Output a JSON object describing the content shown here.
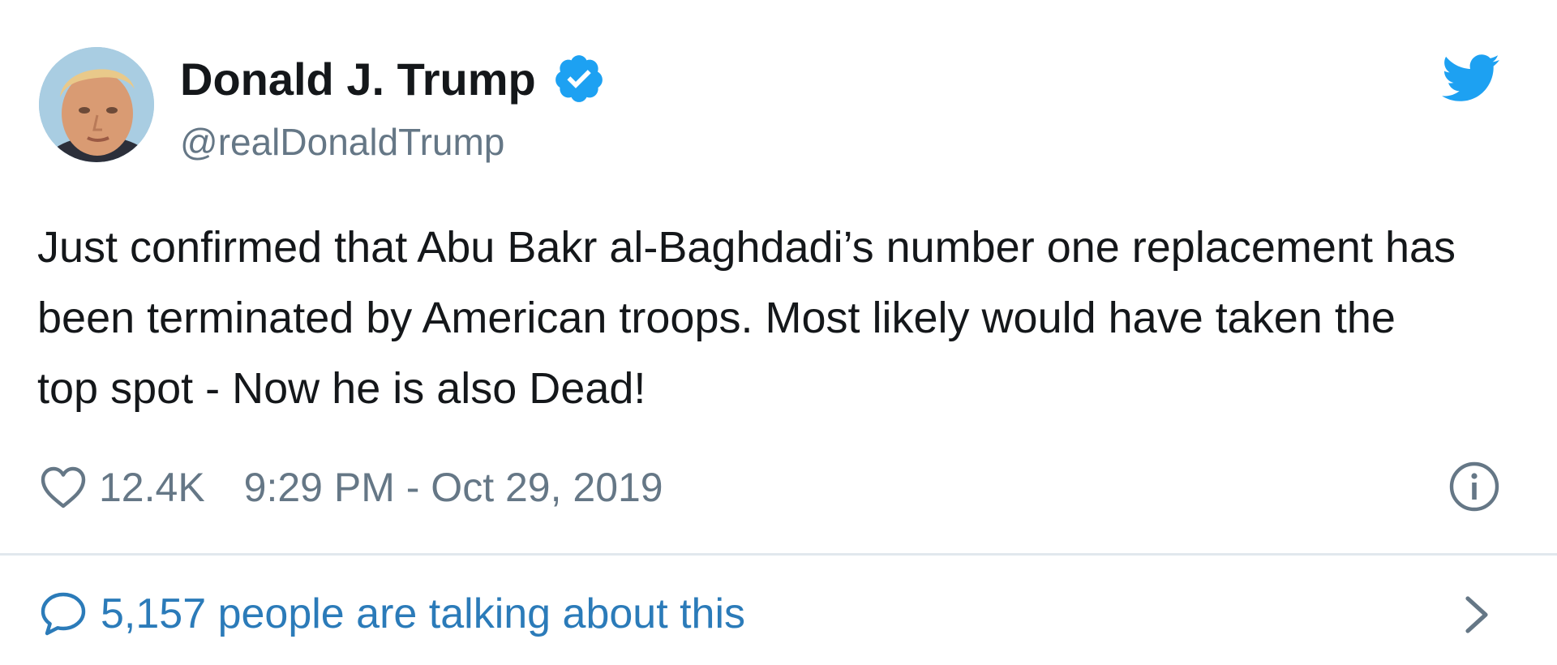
{
  "author": {
    "display_name": "Donald J. Trump",
    "handle": "@realDonaldTrump",
    "verified": true
  },
  "tweet": {
    "text": "Just confirmed that Abu Bakr al-Baghdadi’s number one replacement has been terminated by American troops. Most likely would have taken the top spot - Now he is also Dead!"
  },
  "meta": {
    "like_count": "12.4K",
    "timestamp": "9:29 PM - Oct 29, 2019"
  },
  "footer": {
    "talking_text": "5,157 people are talking about this"
  },
  "icons": {
    "brand": "twitter-bird-icon",
    "verified": "verified-badge-icon",
    "like": "heart-icon",
    "info": "info-icon",
    "reply": "speech-bubble-icon",
    "expand": "chevron-right-icon"
  },
  "colors": {
    "twitter_blue": "#1da1f2",
    "link_blue": "#2b7bb9",
    "secondary_text": "#657786",
    "primary_text": "#14171a",
    "divider": "#e1e8ed"
  }
}
